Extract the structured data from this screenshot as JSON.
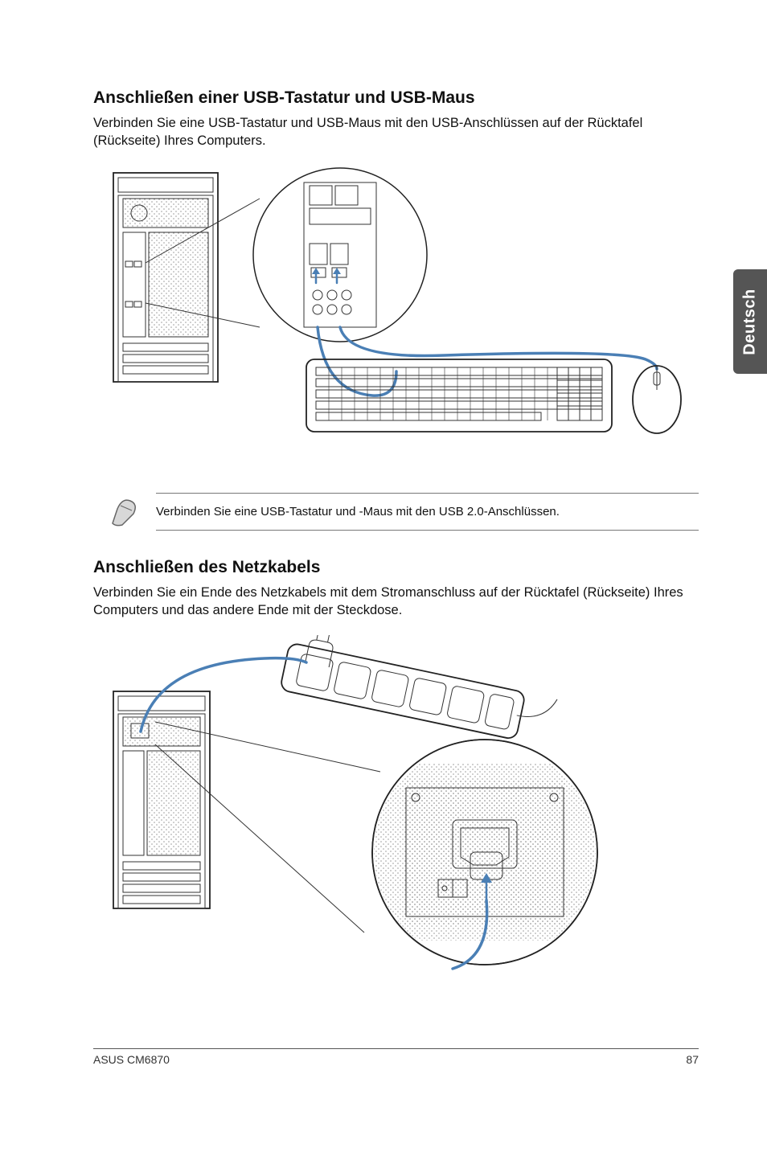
{
  "language_tab": "Deutsch",
  "section1": {
    "heading": "Anschließen einer USB-Tastatur und USB-Maus",
    "paragraph": "Verbinden Sie eine USB-Tastatur und USB-Maus mit den USB-Anschlüssen auf der Rücktafel (Rückseite) Ihres Computers."
  },
  "note": {
    "icon_name": "pencil-icon",
    "text": "Verbinden Sie eine USB-Tastatur und -Maus mit den USB 2.0-Anschlüssen."
  },
  "section2": {
    "heading": "Anschließen des Netzkabels",
    "paragraph": "Verbinden Sie ein Ende des Netzkabels mit dem Stromanschluss auf der Rücktafel (Rückseite) Ihres Computers und das andere Ende mit der Steckdose."
  },
  "footer": {
    "product": "ASUS CM6870",
    "page_number": "87"
  }
}
